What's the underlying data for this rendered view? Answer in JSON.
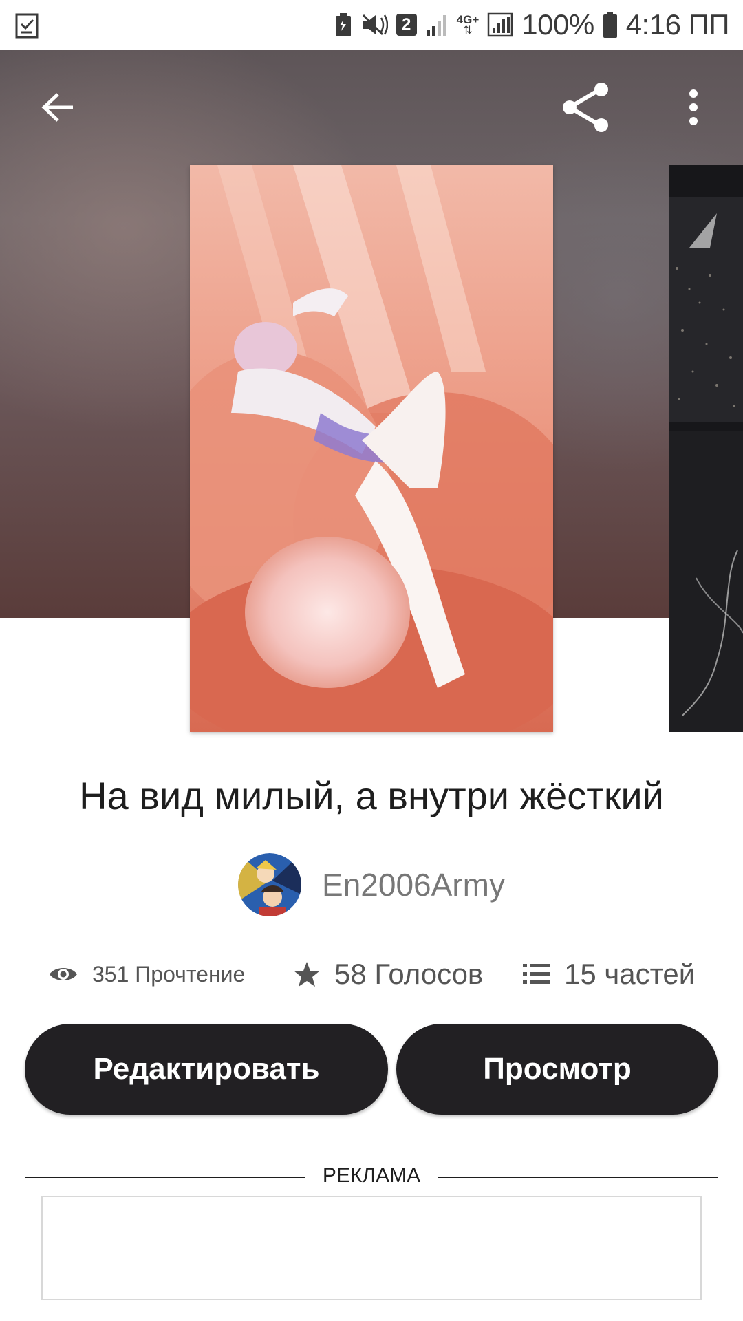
{
  "status_bar": {
    "left_icon": "task-check-icon",
    "network_badge": "2",
    "network_type": "4G+",
    "battery_percent": "100%",
    "time": "4:16 ПП"
  },
  "toolbar": {
    "back_icon": "arrow-left-icon",
    "share_icon": "share-icon",
    "more_icon": "more-vertical-icon"
  },
  "story": {
    "title": "На вид милый, а внутри жёсткий",
    "author": "En2006Army"
  },
  "stats": {
    "reads": "351 Прочтение",
    "votes": "58 Голосов",
    "parts": "15 частей"
  },
  "actions": {
    "edit_label": "Редактировать",
    "view_label": "Просмотр"
  },
  "ad": {
    "label": "РЕКЛАМА"
  },
  "colors": {
    "button_bg": "#222023",
    "button_text": "#ffffff",
    "author_text": "#777777"
  }
}
